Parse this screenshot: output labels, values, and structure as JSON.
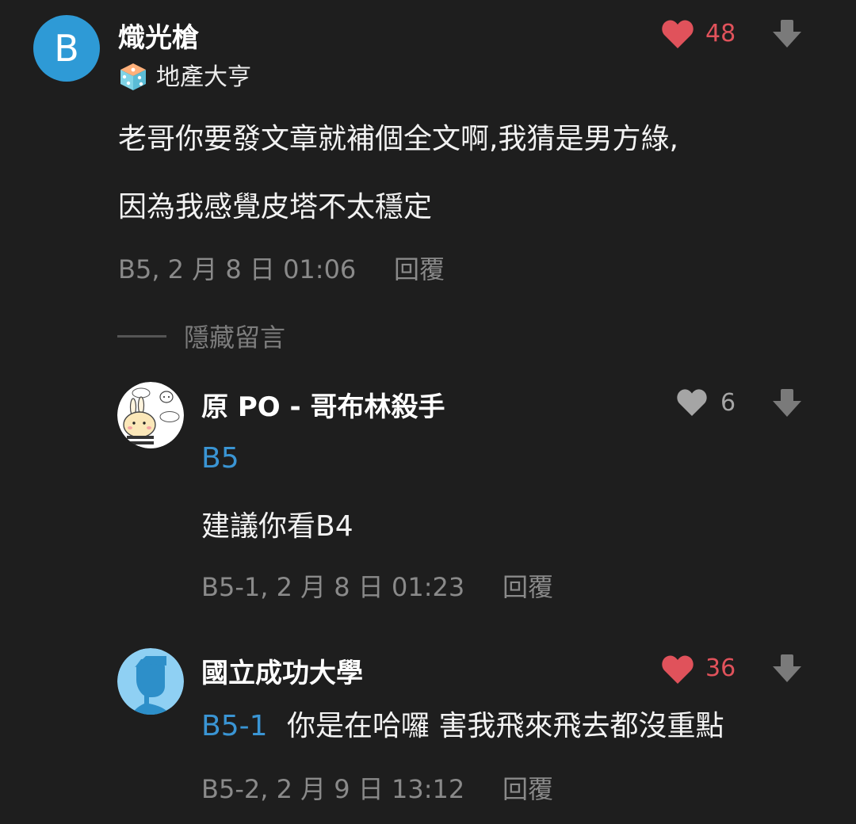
{
  "comments": [
    {
      "avatar_letter": "B",
      "author": "熾光槍",
      "badge": {
        "icon": "dice-badge-icon",
        "label": "地產大亨"
      },
      "likes": "48",
      "liked": true,
      "body_lines": [
        "老哥你要發文章就補個全文啊,我猜是男方綠,",
        "因為我感覺皮塔不太穩定"
      ],
      "meta": "B5, 2 月 8 日 01:06",
      "reply_label": "回覆"
    }
  ],
  "hide_replies_label": "隱藏留言",
  "replies": [
    {
      "avatar": "chiikawa-sticker-avatar",
      "author": "原 PO - 哥布林殺手",
      "likes": "6",
      "liked": false,
      "floor_ref": "B5",
      "body": "建議你看B4",
      "meta": "B5-1, 2 月 8 日 01:23",
      "reply_label": "回覆"
    },
    {
      "avatar": "default-person-avatar",
      "author": "國立成功大學",
      "likes": "36",
      "liked": true,
      "floor_ref": "B5-1",
      "body": "你是在哈囉 害我飛來飛去都沒重點",
      "meta": "B5-2, 2 月 9 日 13:12",
      "reply_label": "回覆"
    }
  ],
  "colors": {
    "background": "#1e1e1e",
    "like_active": "#e0525b",
    "like_inactive": "#a5a5a5",
    "floor_link": "#3a95d4",
    "avatar_blue": "#2e9ad6",
    "meta_gray": "#8a8a8a"
  }
}
